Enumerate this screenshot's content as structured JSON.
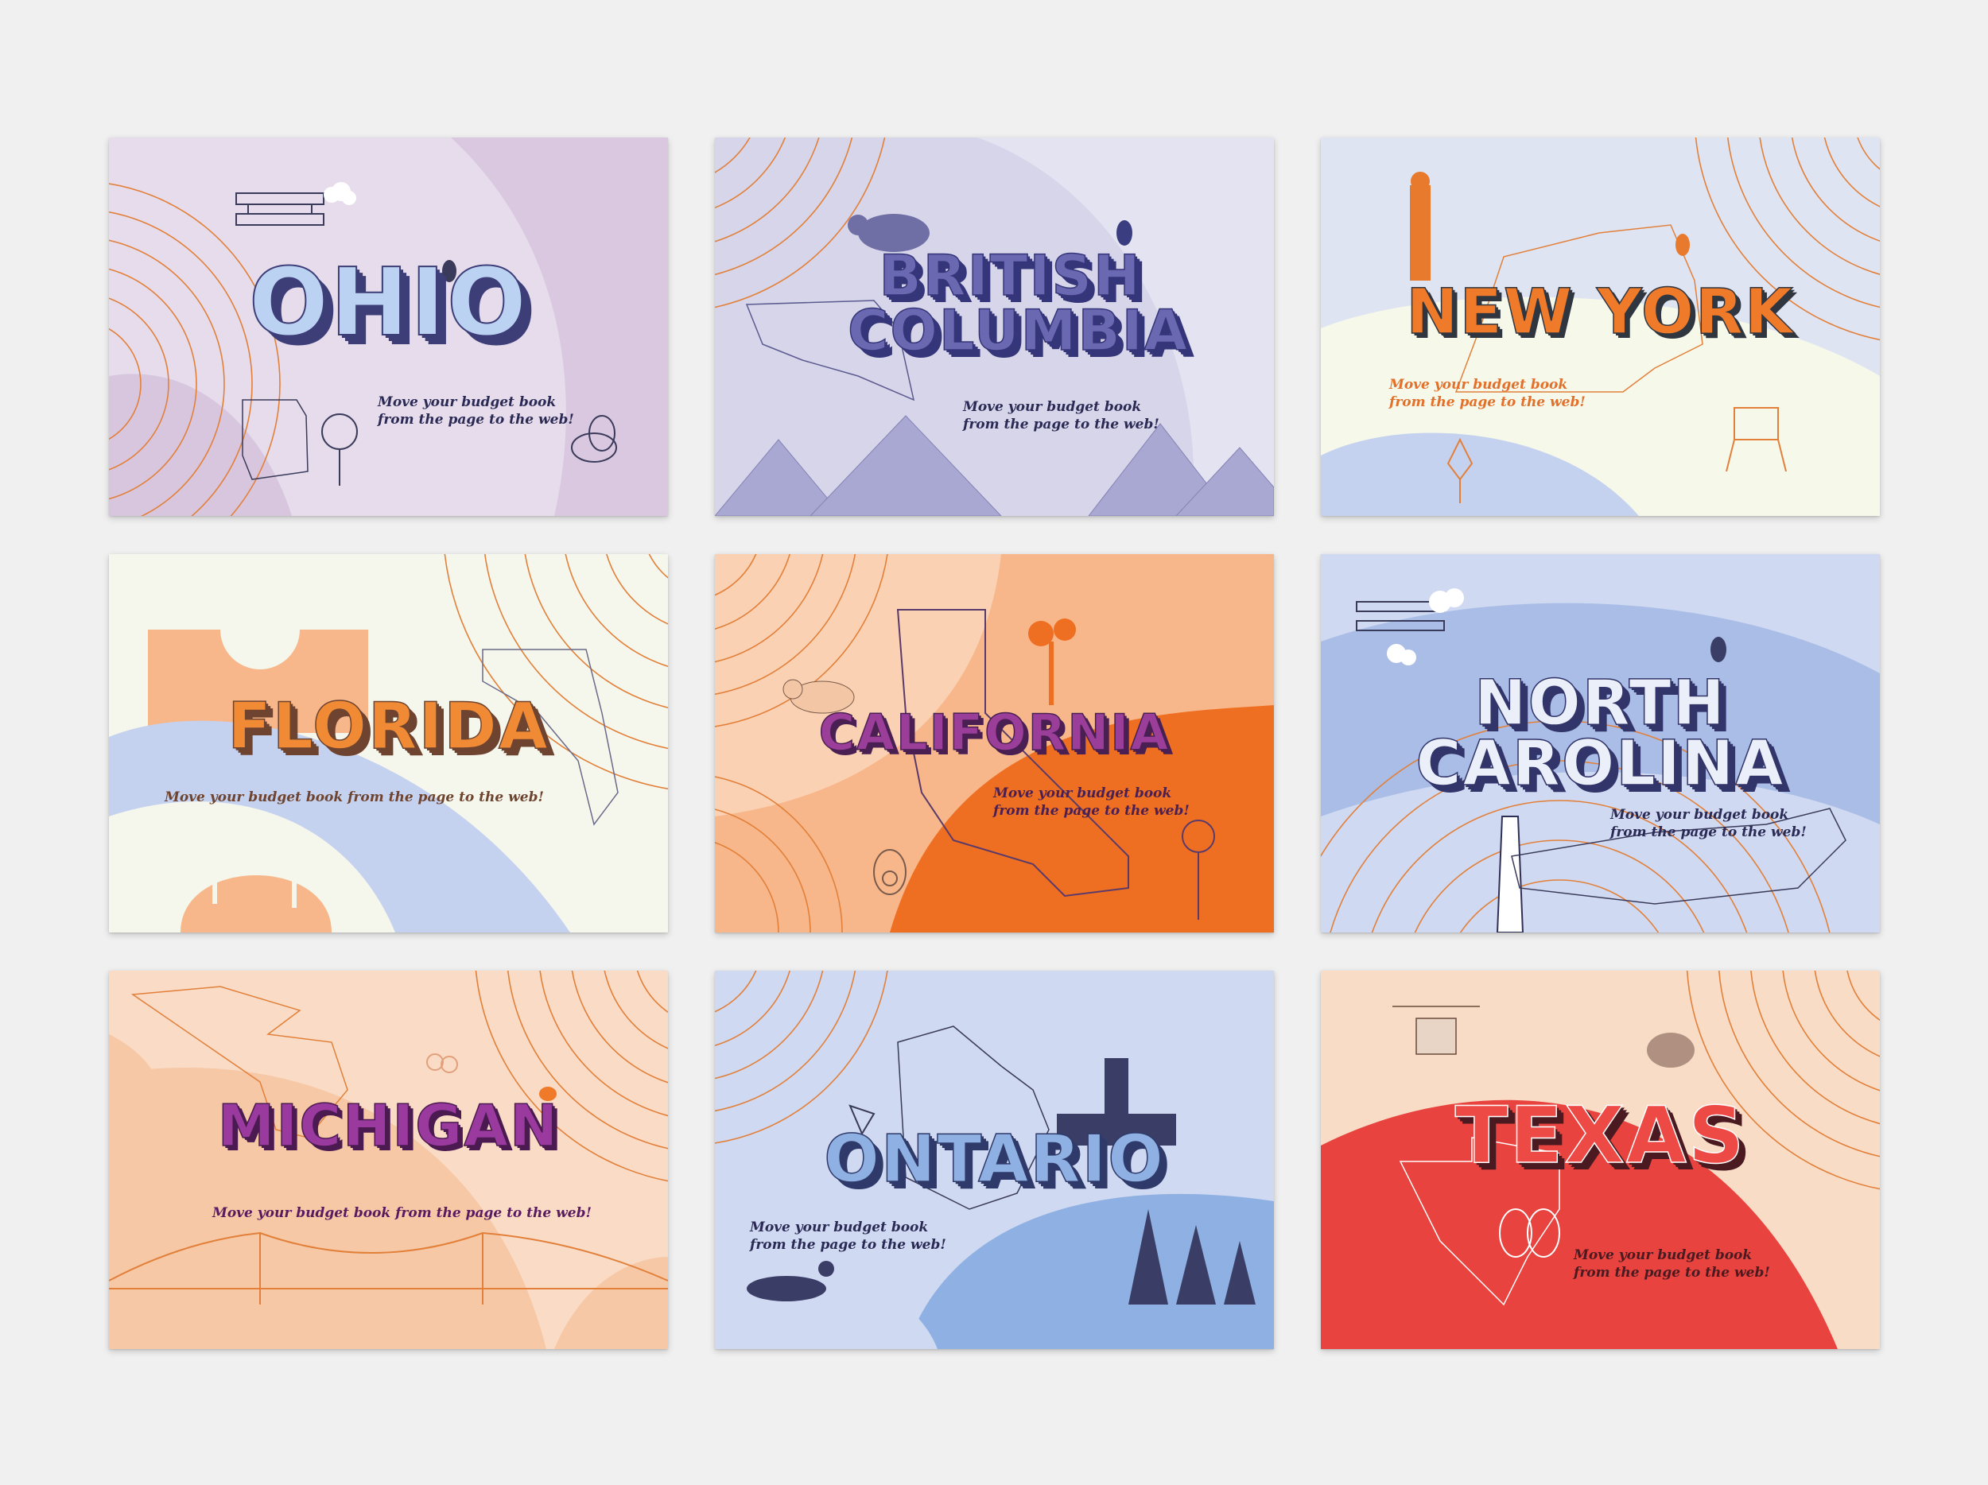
{
  "cards": [
    {
      "title": "OHIO",
      "tagline_1": "Move your budget book",
      "tagline_2": "from the page to the web!"
    },
    {
      "title_1": "BRITISH",
      "title_2": "COLUMBIA",
      "tagline_1": "Move your budget book",
      "tagline_2": "from the page to the web!"
    },
    {
      "title": "NEW YORK",
      "tagline_1": "Move your budget book",
      "tagline_2": "from the page to the web!"
    },
    {
      "title": "FLORIDA",
      "tagline": "Move your budget book from the page to the web!"
    },
    {
      "title": "CALIFORNIA",
      "tagline_1": "Move your budget book",
      "tagline_2": "from the page to the web!"
    },
    {
      "title_1": "NORTH",
      "title_2": "CAROLINA",
      "tagline_1": "Move your budget book",
      "tagline_2": "from the page to the web!"
    },
    {
      "title": "MICHIGAN",
      "tagline": "Move your budget book from the page to the web!"
    },
    {
      "title": "ONTARIO",
      "tagline_1": "Move your budget book",
      "tagline_2": "from the page to the web!"
    },
    {
      "title": "TEXAS",
      "tagline_1": "Move your budget book",
      "tagline_2": "from the page to the web!"
    }
  ],
  "colors": {
    "ohio": "#e6dcec",
    "british_columbia": "#d6d5e9",
    "new_york": "#dfe4f3",
    "florida": "#f6f7ec",
    "california": "#f7b78a",
    "north_carolina": "#a9bde6",
    "michigan": "#f9dbc6",
    "ontario": "#cfd9f1",
    "texas": "#f8dcc6"
  }
}
